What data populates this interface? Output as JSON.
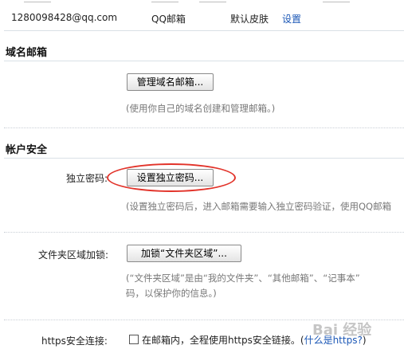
{
  "account_row": {
    "email": "1280098428@qq.com",
    "mailbox": "QQ邮箱",
    "skin": "默认皮肤",
    "settings_link": "设置"
  },
  "domain_mail": {
    "title": "域名邮箱",
    "manage_button": "管理域名邮箱...",
    "help": "(使用你自己的域名创建和管理邮箱。)"
  },
  "account_security": {
    "title": "帐户安全",
    "independent_password": {
      "label": "独立密码:",
      "button": "设置独立密码...",
      "help": "(设置独立密码后，进入邮箱需要输入独立密码验证，使用QQ邮箱"
    },
    "folder_lock": {
      "label": "文件夹区域加锁:",
      "button": "加锁“文件夹区域”...",
      "help_line1": "(“文件夹区域”是由“我的文件夹”、“其他邮箱”、“记事本”",
      "help_line2": "码，以保护你的信息。)"
    },
    "https": {
      "label": "https安全连接:",
      "checkbox_text": "在邮箱内，全程使用https安全链接。(",
      "link": "什么是https?",
      "close": ")"
    }
  },
  "watermark": "Bai 经验",
  "colors": {
    "link": "#1b57b6",
    "annotation_oval": "#e2332a",
    "divider": "#d9e0e6"
  }
}
